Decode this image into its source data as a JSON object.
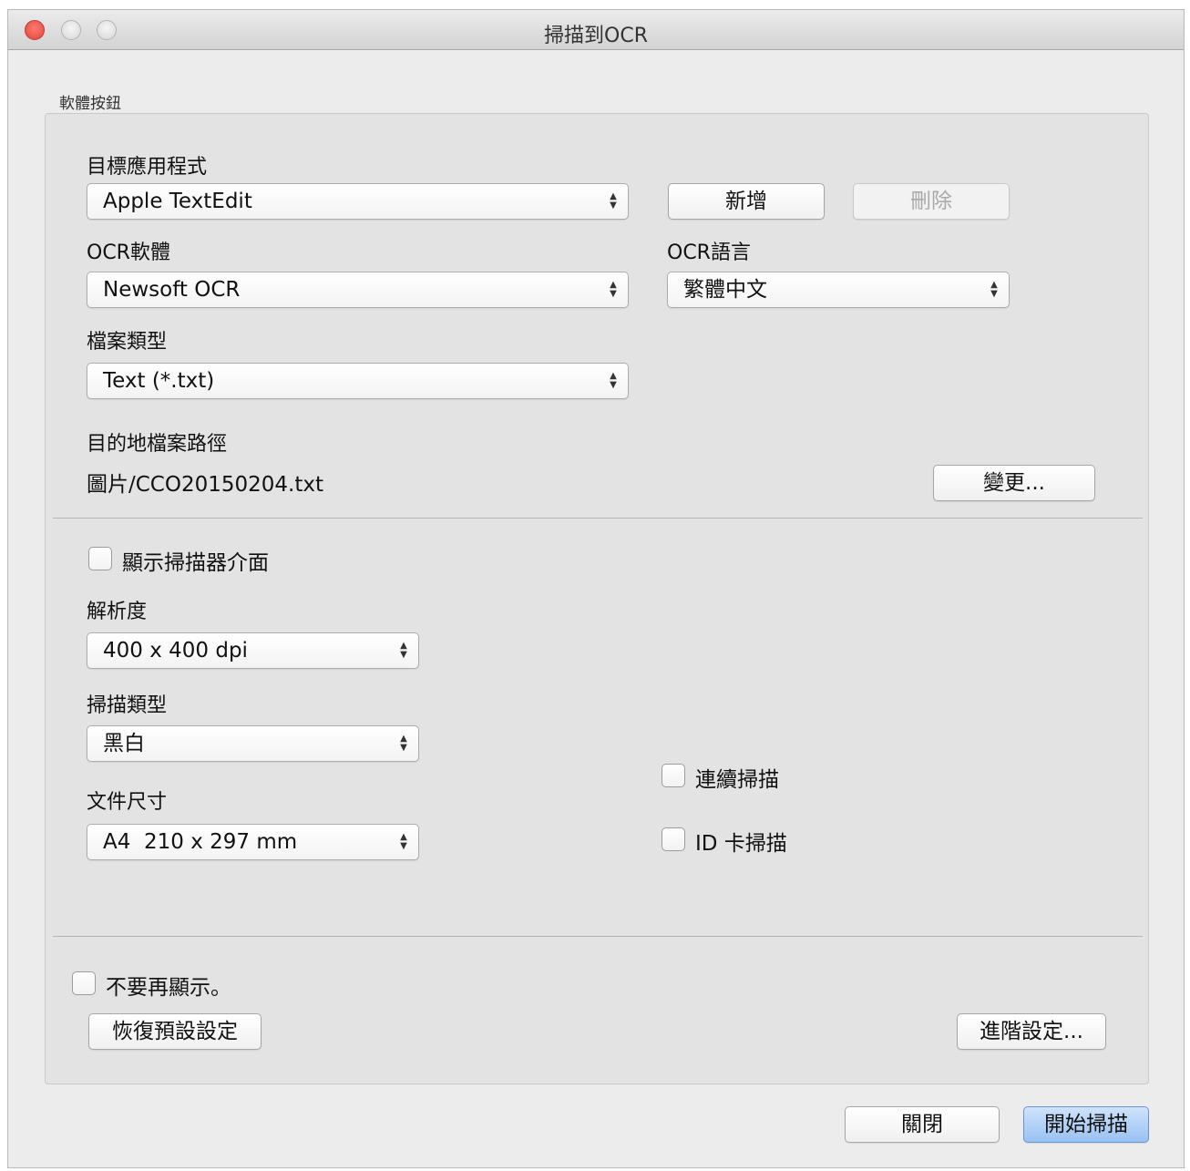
{
  "window": {
    "title": "掃描到OCR"
  },
  "group": {
    "label": "軟體按鈕"
  },
  "target_app": {
    "label": "目標應用程式",
    "value": "Apple TextEdit",
    "add_label": "新增",
    "delete_label": "刪除"
  },
  "ocr_software": {
    "label": "OCR軟體",
    "value": "Newsoft OCR"
  },
  "ocr_language": {
    "label": "OCR語言",
    "value": "繁體中文"
  },
  "file_type": {
    "label": "檔案類型",
    "value": "Text (*.txt)"
  },
  "destination": {
    "label": "目的地檔案路徑",
    "path": "圖片/CCO20150204.txt",
    "change_label": "變更..."
  },
  "show_scanner_ui": {
    "label": "顯示掃描器介面",
    "checked": false
  },
  "resolution": {
    "label": "解析度",
    "value": "400 x 400 dpi"
  },
  "scan_type": {
    "label": "掃描類型",
    "value": "黑白"
  },
  "document_size": {
    "label": "文件尺寸",
    "value": "A4  210 x 297 mm"
  },
  "continuous_scan": {
    "label": "連續掃描",
    "checked": false
  },
  "id_card_scan": {
    "label": "ID 卡掃描",
    "checked": false
  },
  "dont_show_again": {
    "label": "不要再顯示。",
    "checked": false
  },
  "restore_defaults_label": "恢復預設設定",
  "advanced_settings_label": "進階設定...",
  "footer": {
    "close_label": "關閉",
    "start_scan_label": "開始掃描"
  }
}
